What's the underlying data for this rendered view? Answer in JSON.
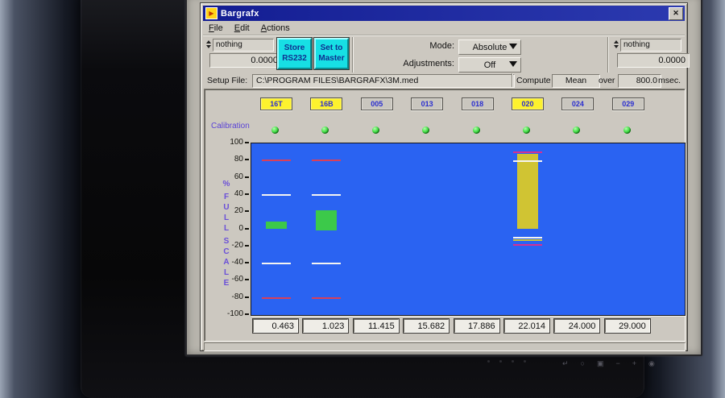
{
  "titlebar": {
    "title": "Bargrafx",
    "close_glyph": "✕",
    "icon_glyph": "▶"
  },
  "menu": {
    "items": [
      "File",
      "Edit",
      "Actions"
    ]
  },
  "controls": {
    "left": {
      "selector": "nothing",
      "value": "0.0000"
    },
    "right": {
      "selector": "nothing",
      "value": "0.0000"
    },
    "store_button": "Store RS232",
    "master_button": "Set to Master",
    "mode_label": "Mode:",
    "mode_value": "Absolute",
    "adjust_label": "Adjustments:",
    "adjust_value": "Off"
  },
  "setup": {
    "label": "Setup File:",
    "path": "C:\\PROGRAM FILES\\BARGRAFX\\3M.med",
    "compute_label": "Compute",
    "compute_method": "Mean",
    "over_label": "over",
    "interval": "800.0",
    "unit": "msec."
  },
  "graph": {
    "calibration_label": "Calibration",
    "axis_unit": "%",
    "axis_words": [
      "FULL",
      "SCALE"
    ],
    "axis_ticks": [
      100,
      80,
      60,
      40,
      20,
      0,
      -20,
      -40,
      -60,
      -80,
      -100
    ],
    "range": [
      -100,
      100
    ],
    "background": "#2a63f2"
  },
  "colors": {
    "limit_red": "#d8405a",
    "limit_magenta": "#d23095",
    "setpoint_white": "#f4f4f2",
    "bar_green": "#3cc94a",
    "bar_yellow": "#d0c433",
    "button_cyan": "#17dfe4",
    "channel_highlight": "#fdf22e",
    "titlebar_navy": "#1a2aa0"
  },
  "channels": [
    {
      "id": "16T",
      "active": true,
      "reading": "0.463",
      "marks": [
        {
          "type": "line",
          "color": "#d8405a",
          "value": 80
        },
        {
          "type": "line",
          "color": "#f4f4f2",
          "value": 40
        },
        {
          "type": "bar",
          "color": "#3cc94a",
          "from": 0,
          "to": 9
        },
        {
          "type": "line",
          "color": "#f4f4f2",
          "value": -40
        },
        {
          "type": "line",
          "color": "#d8405a",
          "value": -80
        }
      ]
    },
    {
      "id": "16B",
      "active": true,
      "reading": "1.023",
      "marks": [
        {
          "type": "line",
          "color": "#d8405a",
          "value": 80
        },
        {
          "type": "line",
          "color": "#f4f4f2",
          "value": 40
        },
        {
          "type": "bar",
          "color": "#3cc94a",
          "from": -1,
          "to": 22
        },
        {
          "type": "line",
          "color": "#f4f4f2",
          "value": -40
        },
        {
          "type": "line",
          "color": "#d8405a",
          "value": -80
        }
      ]
    },
    {
      "id": "005",
      "active": false,
      "reading": "11.415",
      "marks": []
    },
    {
      "id": "013",
      "active": false,
      "reading": "15.682",
      "marks": []
    },
    {
      "id": "018",
      "active": false,
      "reading": "17.886",
      "marks": []
    },
    {
      "id": "020",
      "active": true,
      "reading": "22.014",
      "marks": [
        {
          "type": "line",
          "color": "#d23095",
          "value": 90
        },
        {
          "type": "bar",
          "color": "#d0c433",
          "from": 0,
          "to": 88
        },
        {
          "type": "line",
          "color": "#f4f4f2",
          "value": 79
        },
        {
          "type": "line",
          "color": "#f4f4f2",
          "value": -10
        },
        {
          "type": "line",
          "color": "#d0c433",
          "value": -13
        },
        {
          "type": "line",
          "color": "#d23095",
          "value": -18
        }
      ]
    },
    {
      "id": "024",
      "active": false,
      "reading": "24.000",
      "marks": []
    },
    {
      "id": "029",
      "active": false,
      "reading": "29.000",
      "marks": []
    }
  ],
  "monitor": {
    "osd": [
      {
        "name": "return-icon",
        "glyph": "↵"
      },
      {
        "name": "auto-icon",
        "glyph": "○"
      },
      {
        "name": "menu-icon",
        "glyph": "▣"
      },
      {
        "name": "minus-button",
        "glyph": "−"
      },
      {
        "name": "plus-button",
        "glyph": "+"
      },
      {
        "name": "power-icon",
        "glyph": "◉"
      }
    ]
  }
}
